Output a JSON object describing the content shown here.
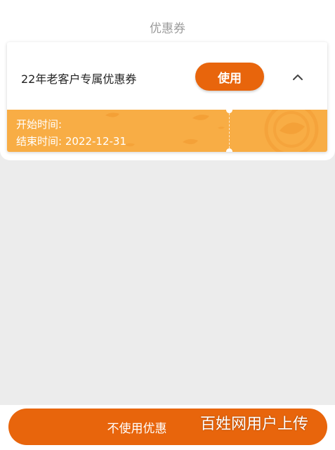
{
  "sheet": {
    "title": "优惠券"
  },
  "coupon": {
    "name": "22年老客户专属优惠券",
    "use_label": "使用",
    "collapse_icon": "chevron-up-icon",
    "start_label": "开始时间:",
    "end_label": "结束时间: 2022-12-31"
  },
  "footer": {
    "button_label": "不使用优惠"
  },
  "watermark": "百姓网用户上传",
  "colors": {
    "accent": "#e8650c",
    "coupon_band": "#f8ad45",
    "background": "#ececec"
  }
}
